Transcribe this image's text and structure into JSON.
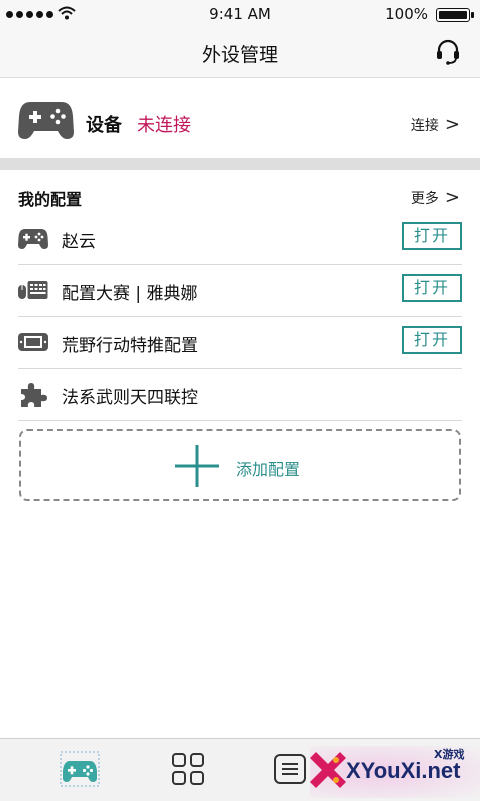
{
  "status_bar": {
    "time": "9:41 AM",
    "battery": "100%"
  },
  "header": {
    "title": "外设管理",
    "support_icon": "headset-icon"
  },
  "device": {
    "label": "设备",
    "status": "未连接",
    "status_color": "#c2185b",
    "connect_label": "连接",
    "icon": "gamepad-icon"
  },
  "configs": {
    "title": "我的配置",
    "more_label": "更多",
    "items": [
      {
        "name": "赵云",
        "icon": "gamepad-icon",
        "action": "打开"
      },
      {
        "name": "配置大赛 | 雅典娜",
        "icon": "keyboard-mouse-icon",
        "action": "打开"
      },
      {
        "name": "荒野行动特推配置",
        "icon": "tablet-device-icon",
        "action": "打开"
      },
      {
        "name": "法系武则天四联控",
        "icon": "puzzle-icon"
      }
    ],
    "add_label": "添加配置"
  },
  "tabbar": {
    "tabs": [
      {
        "icon": "gamepad-tab-icon",
        "active": true
      },
      {
        "icon": "grid-icon"
      },
      {
        "icon": "list-icon"
      }
    ]
  },
  "watermark": {
    "text": "XYouXi.net",
    "small": "X游戏"
  },
  "colors": {
    "accent": "#2a8f8c",
    "alert": "#c2185b"
  }
}
